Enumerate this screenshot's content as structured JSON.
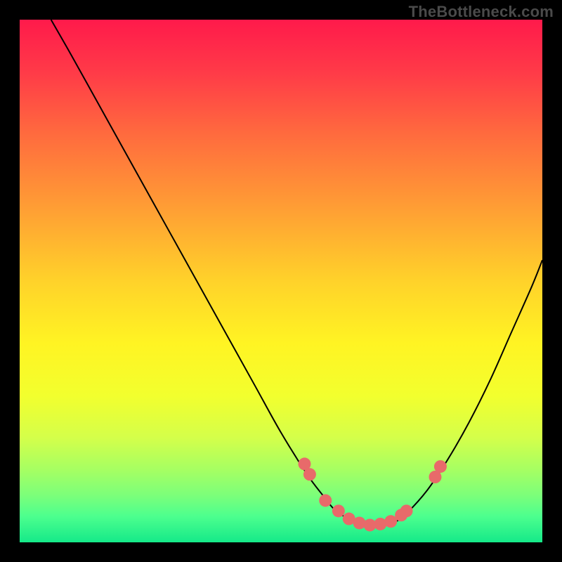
{
  "watermark": "TheBottleneck.com",
  "chart_data": {
    "type": "line",
    "title": "",
    "xlabel": "",
    "ylabel": "",
    "xlim": [
      0,
      100
    ],
    "ylim": [
      0,
      100
    ],
    "series": [
      {
        "name": "curve",
        "x": [
          6,
          10,
          15,
          20,
          25,
          30,
          35,
          40,
          45,
          50,
          55,
          58,
          60,
          62,
          64,
          66,
          68,
          70,
          72,
          74,
          78,
          82,
          86,
          90,
          94,
          98,
          100
        ],
        "y": [
          100,
          93,
          84,
          75,
          66,
          57,
          48,
          39,
          30,
          21,
          13,
          9,
          6.5,
          5,
          4,
          3.5,
          3.3,
          3.5,
          4,
          5.5,
          10,
          16,
          23,
          31,
          40,
          49,
          54
        ]
      }
    ],
    "markers": {
      "name": "points",
      "x": [
        54.5,
        55.5,
        58.5,
        61,
        63,
        65,
        67,
        69,
        71,
        73,
        74,
        79.5,
        80.5
      ],
      "y": [
        15,
        13,
        8,
        6,
        4.5,
        3.7,
        3.3,
        3.5,
        4,
        5.2,
        6,
        12.5,
        14.5
      ]
    },
    "gradient_stops": [
      {
        "offset": 0.0,
        "color": "#ff1a4b"
      },
      {
        "offset": 0.1,
        "color": "#ff3a48"
      },
      {
        "offset": 0.22,
        "color": "#ff6b3e"
      },
      {
        "offset": 0.35,
        "color": "#ff9a35"
      },
      {
        "offset": 0.5,
        "color": "#ffd22a"
      },
      {
        "offset": 0.62,
        "color": "#fff423"
      },
      {
        "offset": 0.72,
        "color": "#f2ff2e"
      },
      {
        "offset": 0.8,
        "color": "#d4ff4a"
      },
      {
        "offset": 0.86,
        "color": "#a7ff62"
      },
      {
        "offset": 0.91,
        "color": "#7cff7a"
      },
      {
        "offset": 0.95,
        "color": "#4dff8e"
      },
      {
        "offset": 1.0,
        "color": "#15e989"
      }
    ],
    "marker_color": "#e86a6a",
    "curve_color": "#000000"
  }
}
